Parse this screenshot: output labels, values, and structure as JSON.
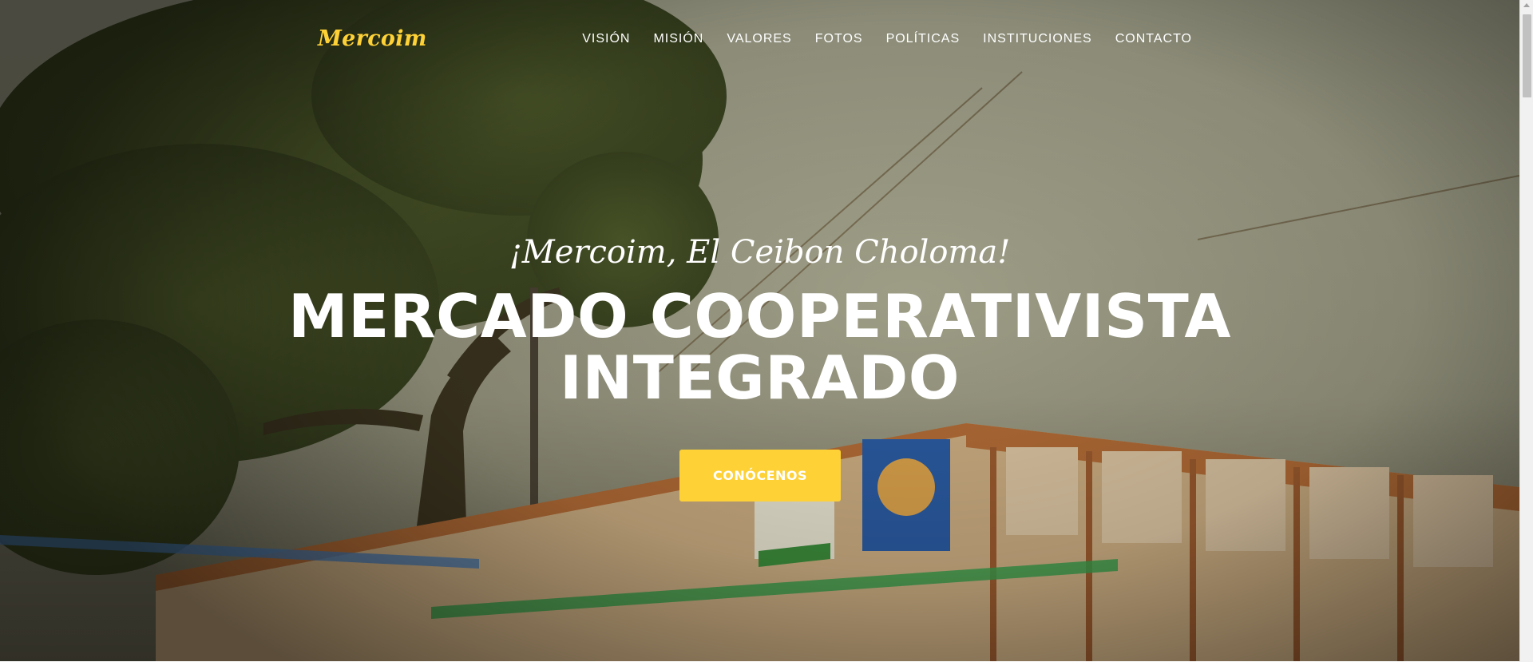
{
  "brand": {
    "name": "Mercoim"
  },
  "nav": {
    "items": [
      {
        "label": "VISIÓN"
      },
      {
        "label": "MISIÓN"
      },
      {
        "label": "VALORES"
      },
      {
        "label": "FOTOS"
      },
      {
        "label": "POLÍTICAS"
      },
      {
        "label": "INSTITUCIONES"
      },
      {
        "label": "CONTACTO"
      }
    ]
  },
  "hero": {
    "lead": "¡Mercoim, El Ceibon Choloma!",
    "headline_line1": "MERCADO COOPERATIVISTA",
    "headline_line2": "INTEGRADO",
    "cta_label": "CONÓCENOS"
  },
  "colors": {
    "accent": "#fed136",
    "text_light": "#ffffff"
  },
  "icons": {
    "scroll_up": "scroll-up-arrow-icon"
  }
}
